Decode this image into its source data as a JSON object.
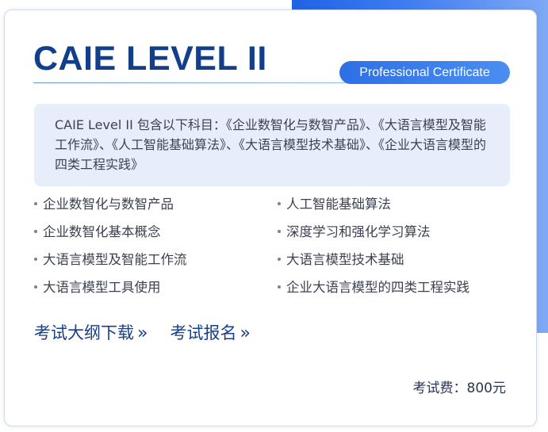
{
  "card": {
    "title": "CAIE LEVEL II",
    "badge": "Professional Certificate",
    "description": "CAIE Level II 包含以下科目：《企业数智化与数智产品》、《大语言模型及智能工作流》、《人工智能基础算法》、《大语言模型技术基础》、《企业大语言模型的四类工程实践》"
  },
  "subjects": [
    "企业数智化与数智产品",
    "人工智能基础算法",
    "企业数智化基本概念",
    "深度学习和强化学习算法",
    "大语言模型及智能工作流",
    "大语言模型技术基础",
    "大语言模型工具使用",
    "企业大语言模型的四类工程实践"
  ],
  "links": {
    "syllabus": "考试大纲下载",
    "register": "考试报名",
    "chevron": "»"
  },
  "fee": {
    "text": "考试费：800元"
  },
  "colors": {
    "title": "#113f8c",
    "accent": "#2f6fe6",
    "info_bg": "#e6edfb",
    "link": "#173f8a"
  }
}
